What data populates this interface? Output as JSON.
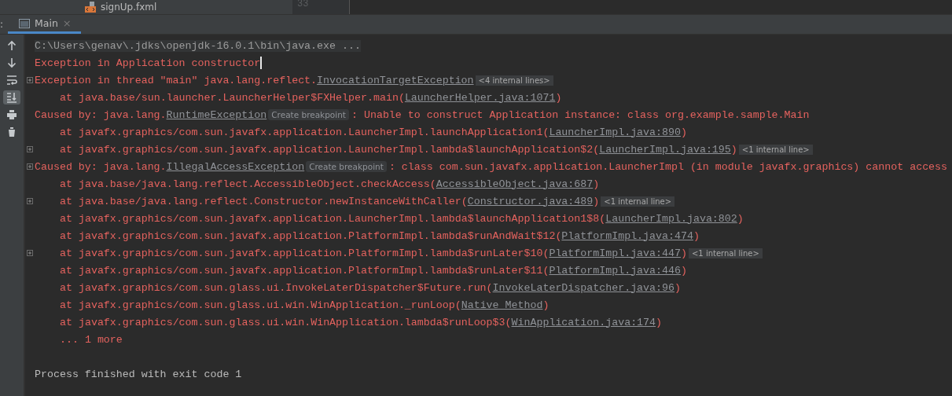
{
  "project_tree": {
    "file": "signUp.fxml"
  },
  "editor": {
    "line_number": "33"
  },
  "tool_window": {
    "label": ":",
    "tabs": [
      {
        "label": "Main",
        "selected": true,
        "close": "×"
      }
    ]
  },
  "toolbar": [
    {
      "kind": "up",
      "selected": false
    },
    {
      "kind": "down",
      "selected": false
    },
    {
      "kind": "wrap",
      "selected": false
    },
    {
      "kind": "scroll-end",
      "selected": true
    },
    {
      "kind": "print",
      "selected": false
    },
    {
      "kind": "trash",
      "selected": false
    }
  ],
  "console": [
    {
      "kind": "command",
      "foldable": false,
      "indent": false,
      "caret": false,
      "segments": [
        {
          "kind": "text",
          "text": "C:\\Users\\genav\\.jdks\\openjdk-16.0.1\\bin\\java.exe ..."
        }
      ]
    },
    {
      "kind": "error",
      "foldable": false,
      "indent": false,
      "caret": true,
      "segments": [
        {
          "kind": "text",
          "text": "Exception in Application constructor"
        }
      ]
    },
    {
      "kind": "error",
      "foldable": true,
      "indent": false,
      "caret": false,
      "segments": [
        {
          "kind": "text",
          "text": "Exception in thread \"main\" java.lang.reflect."
        },
        {
          "kind": "link",
          "text": "InvocationTargetException"
        },
        {
          "kind": "fold",
          "text": "<4 internal lines>"
        }
      ]
    },
    {
      "kind": "error",
      "foldable": false,
      "indent": true,
      "caret": false,
      "segments": [
        {
          "kind": "text",
          "text": "at java.base/sun.launcher.LauncherHelper$FXHelper.main("
        },
        {
          "kind": "link",
          "text": "LauncherHelper.java:1071"
        },
        {
          "kind": "text",
          "text": ")"
        }
      ]
    },
    {
      "kind": "error",
      "foldable": false,
      "indent": false,
      "caret": false,
      "segments": [
        {
          "kind": "text",
          "text": "Caused by: java.lang."
        },
        {
          "kind": "link",
          "text": "RuntimeException"
        },
        {
          "kind": "hint",
          "text": "Create breakpoint"
        },
        {
          "kind": "text",
          "text": ": Unable to construct Application instance: class org.example.sample.Main"
        }
      ]
    },
    {
      "kind": "error",
      "foldable": false,
      "indent": true,
      "caret": false,
      "segments": [
        {
          "kind": "text",
          "text": "at javafx.graphics/com.sun.javafx.application.LauncherImpl.launchApplication1("
        },
        {
          "kind": "link",
          "text": "LauncherImpl.java:890"
        },
        {
          "kind": "text",
          "text": ")"
        }
      ]
    },
    {
      "kind": "error",
      "foldable": true,
      "indent": true,
      "caret": false,
      "segments": [
        {
          "kind": "text",
          "text": "at javafx.graphics/com.sun.javafx.application.LauncherImpl.lambda$launchApplication$2("
        },
        {
          "kind": "link",
          "text": "LauncherImpl.java:195"
        },
        {
          "kind": "text",
          "text": ")"
        },
        {
          "kind": "fold",
          "text": "<1 internal line>"
        }
      ]
    },
    {
      "kind": "error",
      "foldable": true,
      "indent": false,
      "caret": false,
      "segments": [
        {
          "kind": "text",
          "text": "Caused by: java.lang."
        },
        {
          "kind": "link",
          "text": "IllegalAccessException"
        },
        {
          "kind": "hint",
          "text": "Create breakpoint"
        },
        {
          "kind": "text",
          "text": ": class com.sun.javafx.application.LauncherImpl (in module javafx.graphics) cannot access"
        }
      ]
    },
    {
      "kind": "error",
      "foldable": false,
      "indent": true,
      "caret": false,
      "segments": [
        {
          "kind": "text",
          "text": "at java.base/java.lang.reflect.AccessibleObject.checkAccess("
        },
        {
          "kind": "link",
          "text": "AccessibleObject.java:687"
        },
        {
          "kind": "text",
          "text": ")"
        }
      ]
    },
    {
      "kind": "error",
      "foldable": true,
      "indent": true,
      "caret": false,
      "segments": [
        {
          "kind": "text",
          "text": "at java.base/java.lang.reflect.Constructor.newInstanceWithCaller("
        },
        {
          "kind": "link",
          "text": "Constructor.java:489"
        },
        {
          "kind": "text",
          "text": ")"
        },
        {
          "kind": "fold",
          "text": "<1 internal line>"
        }
      ]
    },
    {
      "kind": "error",
      "foldable": false,
      "indent": true,
      "caret": false,
      "segments": [
        {
          "kind": "text",
          "text": "at javafx.graphics/com.sun.javafx.application.LauncherImpl.lambda$launchApplication1$8("
        },
        {
          "kind": "link",
          "text": "LauncherImpl.java:802"
        },
        {
          "kind": "text",
          "text": ")"
        }
      ]
    },
    {
      "kind": "error",
      "foldable": false,
      "indent": true,
      "caret": false,
      "segments": [
        {
          "kind": "text",
          "text": "at javafx.graphics/com.sun.javafx.application.PlatformImpl.lambda$runAndWait$12("
        },
        {
          "kind": "link",
          "text": "PlatformImpl.java:474"
        },
        {
          "kind": "text",
          "text": ")"
        }
      ]
    },
    {
      "kind": "error",
      "foldable": true,
      "indent": true,
      "caret": false,
      "segments": [
        {
          "kind": "text",
          "text": "at javafx.graphics/com.sun.javafx.application.PlatformImpl.lambda$runLater$10("
        },
        {
          "kind": "link",
          "text": "PlatformImpl.java:447"
        },
        {
          "kind": "text",
          "text": ")"
        },
        {
          "kind": "fold",
          "text": "<1 internal line>"
        }
      ]
    },
    {
      "kind": "error",
      "foldable": false,
      "indent": true,
      "caret": false,
      "segments": [
        {
          "kind": "text",
          "text": "at javafx.graphics/com.sun.javafx.application.PlatformImpl.lambda$runLater$11("
        },
        {
          "kind": "link",
          "text": "PlatformImpl.java:446"
        },
        {
          "kind": "text",
          "text": ")"
        }
      ]
    },
    {
      "kind": "error",
      "foldable": false,
      "indent": true,
      "caret": false,
      "segments": [
        {
          "kind": "text",
          "text": "at javafx.graphics/com.sun.glass.ui.InvokeLaterDispatcher$Future.run("
        },
        {
          "kind": "link",
          "text": "InvokeLaterDispatcher.java:96"
        },
        {
          "kind": "text",
          "text": ")"
        }
      ]
    },
    {
      "kind": "error",
      "foldable": false,
      "indent": true,
      "caret": false,
      "segments": [
        {
          "kind": "text",
          "text": "at javafx.graphics/com.sun.glass.ui.win.WinApplication._runLoop("
        },
        {
          "kind": "link",
          "text": "Native Method"
        },
        {
          "kind": "text",
          "text": ")"
        }
      ]
    },
    {
      "kind": "error",
      "foldable": false,
      "indent": true,
      "caret": false,
      "segments": [
        {
          "kind": "text",
          "text": "at javafx.graphics/com.sun.glass.ui.win.WinApplication.lambda$runLoop$3("
        },
        {
          "kind": "link",
          "text": "WinApplication.java:174"
        },
        {
          "kind": "text",
          "text": ")"
        }
      ]
    },
    {
      "kind": "error",
      "foldable": false,
      "indent": true,
      "caret": false,
      "segments": [
        {
          "kind": "text",
          "text": "... 1 more"
        }
      ]
    },
    {
      "kind": "blank"
    },
    {
      "kind": "normal",
      "foldable": false,
      "indent": false,
      "caret": false,
      "segments": [
        {
          "kind": "text",
          "text": "Process finished with exit code 1"
        }
      ]
    }
  ]
}
